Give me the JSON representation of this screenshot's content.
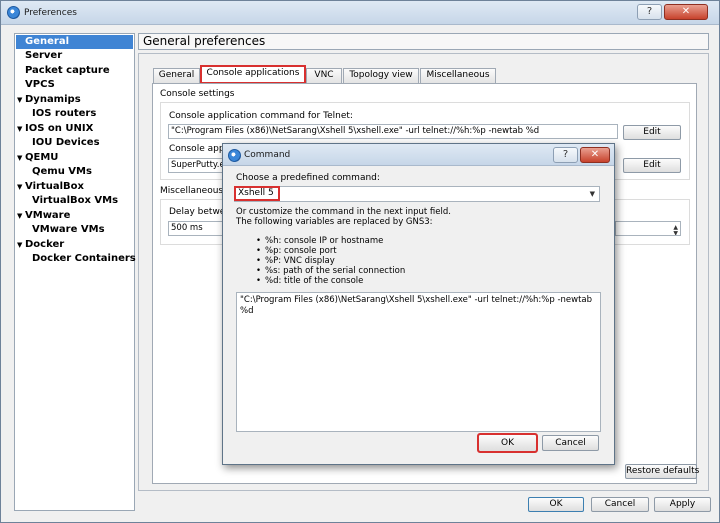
{
  "window": {
    "title": "Preferences"
  },
  "sidebar": {
    "items": [
      {
        "label": "General",
        "arrow": ""
      },
      {
        "label": "Server",
        "arrow": ""
      },
      {
        "label": "Packet capture",
        "arrow": ""
      },
      {
        "label": "VPCS",
        "arrow": ""
      },
      {
        "label": "Dynamips",
        "arrow": "▼"
      },
      {
        "label": "IOS routers",
        "arrow": ""
      },
      {
        "label": "IOS on UNIX",
        "arrow": "▼"
      },
      {
        "label": "IOU Devices",
        "arrow": ""
      },
      {
        "label": "QEMU",
        "arrow": "▼"
      },
      {
        "label": "Qemu VMs",
        "arrow": ""
      },
      {
        "label": "VirtualBox",
        "arrow": "▼"
      },
      {
        "label": "VirtualBox VMs",
        "arrow": ""
      },
      {
        "label": "VMware",
        "arrow": "▼"
      },
      {
        "label": "VMware VMs",
        "arrow": ""
      },
      {
        "label": "Docker",
        "arrow": "▼"
      },
      {
        "label": "Docker Containers",
        "arrow": ""
      }
    ]
  },
  "page_title": "General preferences",
  "tabs": [
    "General",
    "Console applications",
    "VNC",
    "Topology view",
    "Miscellaneous"
  ],
  "console_settings": {
    "group_title": "Console settings",
    "telnet_label": "Console application command for Telnet:",
    "telnet_value": "\"C:\\Program Files (x86)\\NetSarang\\Xshell 5\\xshell.exe\" -url telnet://%h:%p -newtab %d",
    "serial_label": "Console appli",
    "serial_value": "SuperPutty.e",
    "edit_label": "Edit"
  },
  "misc": {
    "group_title": "Miscellaneous",
    "delay_label": "Delay betwee",
    "delay_value": "500 ms"
  },
  "restore_defaults_label": "Restore defaults",
  "footer": {
    "ok": "OK",
    "cancel": "Cancel",
    "apply": "Apply"
  },
  "dialog": {
    "title": "Command",
    "help_label": "?",
    "choose_label": "Choose a predefined command:",
    "selected_command": "Xshell 5",
    "explain_line1": "Or customize the command in the next input field.",
    "explain_line2": "The following variables are replaced by GNS3:",
    "variables": [
      "%h: console IP or hostname",
      "%p: console port",
      "%P: VNC display",
      "%s: path of the serial connection",
      "%d: title of the console"
    ],
    "command_text": "\"C:\\Program Files (x86)\\NetSarang\\Xshell 5\\xshell.exe\" -url telnet://%h:%p -newtab %d",
    "ok": "OK",
    "cancel": "Cancel"
  }
}
